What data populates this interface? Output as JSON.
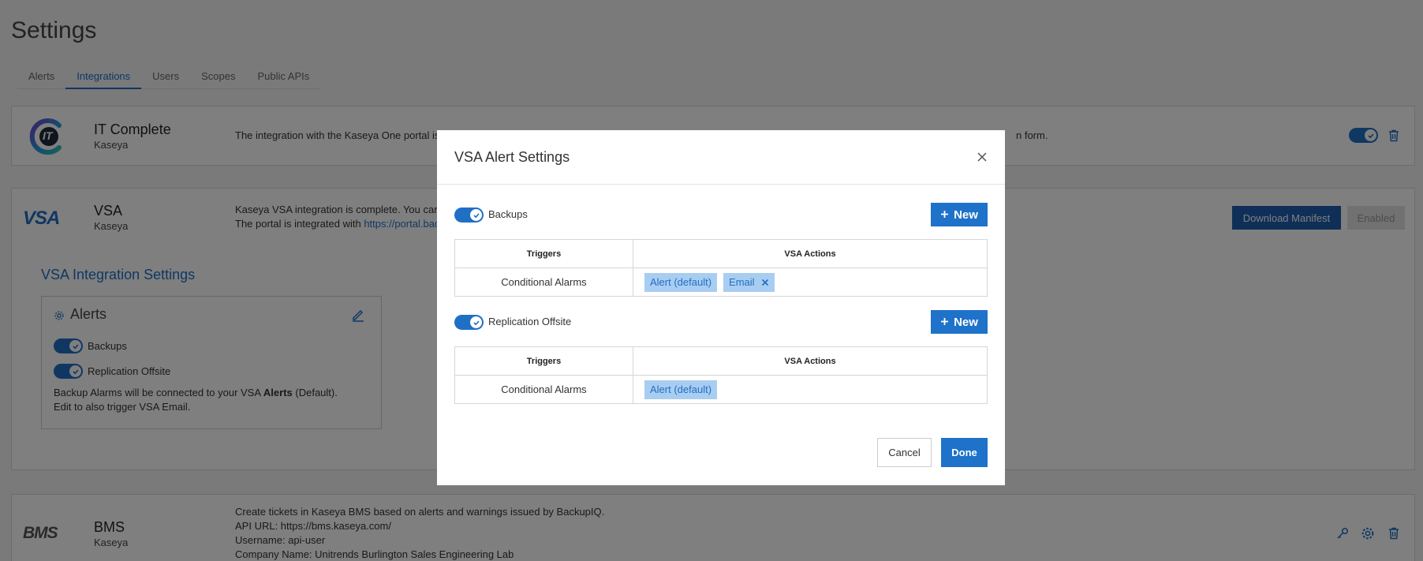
{
  "page": {
    "title": "Settings"
  },
  "tabs": [
    {
      "label": "Alerts"
    },
    {
      "label": "Integrations"
    },
    {
      "label": "Users"
    },
    {
      "label": "Scopes"
    },
    {
      "label": "Public APIs"
    }
  ],
  "active_tab": "Integrations",
  "it_complete": {
    "logo_text": "IT",
    "name": "IT Complete",
    "vendor": "Kaseya",
    "description": "The integration with the Kaseya One portal is c",
    "description_tail": "n form.",
    "enabled": true
  },
  "vsa": {
    "logo_text": "VSA",
    "name": "VSA",
    "vendor": "Kaseya",
    "description_line1": "Kaseya VSA integration is complete. You can r",
    "description_line2_prefix": "The portal is integrated with ",
    "description_link": "https://portal.bac",
    "download_button": "Download Manifest",
    "enabled_button": "Enabled",
    "settings_title": "VSA Integration Settings",
    "alerts_box": {
      "title": "Alerts",
      "backups_label": "Backups",
      "replication_label": "Replication Offsite",
      "note_prefix": "Backup Alarms will be connected to your VSA ",
      "note_bold": "Alerts",
      "note_suffix": " (Default).",
      "note_line2": "Edit to also trigger VSA Email."
    }
  },
  "bms": {
    "logo_text": "BMS",
    "name": "BMS",
    "vendor": "Kaseya",
    "line1": "Create tickets in Kaseya BMS based on alerts and warnings issued by BackupIQ.",
    "line2": "API URL: https://bms.kaseya.com/",
    "line3": "Username: api-user",
    "line4": "Company Name: Unitrends Burlington Sales Engineering Lab"
  },
  "modal": {
    "title": "VSA Alert Settings",
    "sections": [
      {
        "label": "Backups",
        "enabled": true,
        "new_button": "New",
        "headers": {
          "triggers": "Triggers",
          "actions": "VSA Actions"
        },
        "trigger": "Conditional Alarms",
        "actions": [
          {
            "label": "Alert (default)",
            "removable": false
          },
          {
            "label": "Email",
            "removable": true
          }
        ]
      },
      {
        "label": "Replication Offsite",
        "enabled": true,
        "new_button": "New",
        "headers": {
          "triggers": "Triggers",
          "actions": "VSA Actions"
        },
        "trigger": "Conditional Alarms",
        "actions": [
          {
            "label": "Alert (default)",
            "removable": false
          }
        ]
      }
    ],
    "cancel_button": "Cancel",
    "done_button": "Done"
  },
  "colors": {
    "accent": "#1f6fc5",
    "button_blue": "#1f72c9",
    "chip_bg": "#a9cdf1",
    "overlay": "rgba(0,0,0,0.5)"
  }
}
